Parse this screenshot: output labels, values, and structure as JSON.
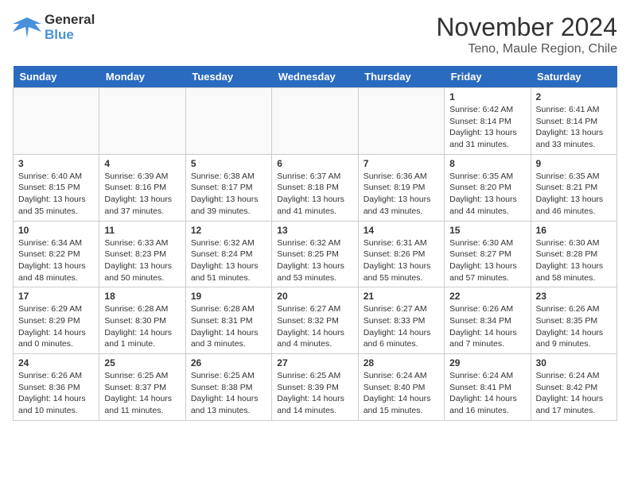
{
  "header": {
    "logo_line1": "General",
    "logo_line2": "Blue",
    "month_title": "November 2024",
    "location": "Teno, Maule Region, Chile"
  },
  "days_of_week": [
    "Sunday",
    "Monday",
    "Tuesday",
    "Wednesday",
    "Thursday",
    "Friday",
    "Saturday"
  ],
  "weeks": [
    [
      {
        "day": "",
        "info": ""
      },
      {
        "day": "",
        "info": ""
      },
      {
        "day": "",
        "info": ""
      },
      {
        "day": "",
        "info": ""
      },
      {
        "day": "",
        "info": ""
      },
      {
        "day": "1",
        "info": "Sunrise: 6:42 AM\nSunset: 8:14 PM\nDaylight: 13 hours\nand 31 minutes."
      },
      {
        "day": "2",
        "info": "Sunrise: 6:41 AM\nSunset: 8:14 PM\nDaylight: 13 hours\nand 33 minutes."
      }
    ],
    [
      {
        "day": "3",
        "info": "Sunrise: 6:40 AM\nSunset: 8:15 PM\nDaylight: 13 hours\nand 35 minutes."
      },
      {
        "day": "4",
        "info": "Sunrise: 6:39 AM\nSunset: 8:16 PM\nDaylight: 13 hours\nand 37 minutes."
      },
      {
        "day": "5",
        "info": "Sunrise: 6:38 AM\nSunset: 8:17 PM\nDaylight: 13 hours\nand 39 minutes."
      },
      {
        "day": "6",
        "info": "Sunrise: 6:37 AM\nSunset: 8:18 PM\nDaylight: 13 hours\nand 41 minutes."
      },
      {
        "day": "7",
        "info": "Sunrise: 6:36 AM\nSunset: 8:19 PM\nDaylight: 13 hours\nand 43 minutes."
      },
      {
        "day": "8",
        "info": "Sunrise: 6:35 AM\nSunset: 8:20 PM\nDaylight: 13 hours\nand 44 minutes."
      },
      {
        "day": "9",
        "info": "Sunrise: 6:35 AM\nSunset: 8:21 PM\nDaylight: 13 hours\nand 46 minutes."
      }
    ],
    [
      {
        "day": "10",
        "info": "Sunrise: 6:34 AM\nSunset: 8:22 PM\nDaylight: 13 hours\nand 48 minutes."
      },
      {
        "day": "11",
        "info": "Sunrise: 6:33 AM\nSunset: 8:23 PM\nDaylight: 13 hours\nand 50 minutes."
      },
      {
        "day": "12",
        "info": "Sunrise: 6:32 AM\nSunset: 8:24 PM\nDaylight: 13 hours\nand 51 minutes."
      },
      {
        "day": "13",
        "info": "Sunrise: 6:32 AM\nSunset: 8:25 PM\nDaylight: 13 hours\nand 53 minutes."
      },
      {
        "day": "14",
        "info": "Sunrise: 6:31 AM\nSunset: 8:26 PM\nDaylight: 13 hours\nand 55 minutes."
      },
      {
        "day": "15",
        "info": "Sunrise: 6:30 AM\nSunset: 8:27 PM\nDaylight: 13 hours\nand 57 minutes."
      },
      {
        "day": "16",
        "info": "Sunrise: 6:30 AM\nSunset: 8:28 PM\nDaylight: 13 hours\nand 58 minutes."
      }
    ],
    [
      {
        "day": "17",
        "info": "Sunrise: 6:29 AM\nSunset: 8:29 PM\nDaylight: 14 hours\nand 0 minutes."
      },
      {
        "day": "18",
        "info": "Sunrise: 6:28 AM\nSunset: 8:30 PM\nDaylight: 14 hours\nand 1 minute."
      },
      {
        "day": "19",
        "info": "Sunrise: 6:28 AM\nSunset: 8:31 PM\nDaylight: 14 hours\nand 3 minutes."
      },
      {
        "day": "20",
        "info": "Sunrise: 6:27 AM\nSunset: 8:32 PM\nDaylight: 14 hours\nand 4 minutes."
      },
      {
        "day": "21",
        "info": "Sunrise: 6:27 AM\nSunset: 8:33 PM\nDaylight: 14 hours\nand 6 minutes."
      },
      {
        "day": "22",
        "info": "Sunrise: 6:26 AM\nSunset: 8:34 PM\nDaylight: 14 hours\nand 7 minutes."
      },
      {
        "day": "23",
        "info": "Sunrise: 6:26 AM\nSunset: 8:35 PM\nDaylight: 14 hours\nand 9 minutes."
      }
    ],
    [
      {
        "day": "24",
        "info": "Sunrise: 6:26 AM\nSunset: 8:36 PM\nDaylight: 14 hours\nand 10 minutes."
      },
      {
        "day": "25",
        "info": "Sunrise: 6:25 AM\nSunset: 8:37 PM\nDaylight: 14 hours\nand 11 minutes."
      },
      {
        "day": "26",
        "info": "Sunrise: 6:25 AM\nSunset: 8:38 PM\nDaylight: 14 hours\nand 13 minutes."
      },
      {
        "day": "27",
        "info": "Sunrise: 6:25 AM\nSunset: 8:39 PM\nDaylight: 14 hours\nand 14 minutes."
      },
      {
        "day": "28",
        "info": "Sunrise: 6:24 AM\nSunset: 8:40 PM\nDaylight: 14 hours\nand 15 minutes."
      },
      {
        "day": "29",
        "info": "Sunrise: 6:24 AM\nSunset: 8:41 PM\nDaylight: 14 hours\nand 16 minutes."
      },
      {
        "day": "30",
        "info": "Sunrise: 6:24 AM\nSunset: 8:42 PM\nDaylight: 14 hours\nand 17 minutes."
      }
    ]
  ]
}
